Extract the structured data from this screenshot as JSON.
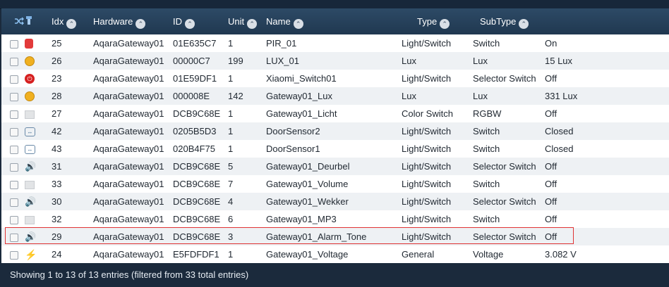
{
  "header": {
    "shuffle_icon": "shuffle-icon",
    "select_icon": "filter-icon",
    "columns": [
      {
        "key": "idx",
        "label": "Idx"
      },
      {
        "key": "hardware",
        "label": "Hardware"
      },
      {
        "key": "id",
        "label": "ID"
      },
      {
        "key": "unit",
        "label": "Unit"
      },
      {
        "key": "name",
        "label": "Name"
      },
      {
        "key": "type",
        "label": "Type"
      },
      {
        "key": "subtype",
        "label": "SubType"
      }
    ]
  },
  "rows": [
    {
      "icon": "motion-sensor-icon",
      "idx": "25",
      "hardware": "AqaraGateway01",
      "id": "01E635C7",
      "unit": "1",
      "name": "PIR_01",
      "type": "Light/Switch",
      "subtype": "Switch",
      "status": "On"
    },
    {
      "icon": "lux-bulb-icon",
      "idx": "26",
      "hardware": "AqaraGateway01",
      "id": "00000C7",
      "unit": "199",
      "name": "LUX_01",
      "type": "Lux",
      "subtype": "Lux",
      "status": "15 Lux"
    },
    {
      "icon": "power-switch-icon",
      "idx": "23",
      "hardware": "AqaraGateway01",
      "id": "01E59DF1",
      "unit": "1",
      "name": "Xiaomi_Switch01",
      "type": "Light/Switch",
      "subtype": "Selector Switch",
      "status": "Off"
    },
    {
      "icon": "lux-bulb-icon",
      "idx": "28",
      "hardware": "AqaraGateway01",
      "id": "000008E",
      "unit": "142",
      "name": "Gateway01_Lux",
      "type": "Lux",
      "subtype": "Lux",
      "status": "331 Lux"
    },
    {
      "icon": "rgb-light-icon",
      "idx": "27",
      "hardware": "AqaraGateway01",
      "id": "DCB9C68E",
      "unit": "1",
      "name": "Gateway01_Licht",
      "type": "Color Switch",
      "subtype": "RGBW",
      "status": "Off"
    },
    {
      "icon": "door-sensor-icon",
      "idx": "42",
      "hardware": "AqaraGateway01",
      "id": "0205B5D3",
      "unit": "1",
      "name": "DoorSensor2",
      "type": "Light/Switch",
      "subtype": "Switch",
      "status": "Closed"
    },
    {
      "icon": "door-sensor-icon",
      "idx": "43",
      "hardware": "AqaraGateway01",
      "id": "020B4F75",
      "unit": "1",
      "name": "DoorSensor1",
      "type": "Light/Switch",
      "subtype": "Switch",
      "status": "Closed"
    },
    {
      "icon": "speaker-icon",
      "idx": "31",
      "hardware": "AqaraGateway01",
      "id": "DCB9C68E",
      "unit": "5",
      "name": "Gateway01_Deurbel",
      "type": "Light/Switch",
      "subtype": "Selector Switch",
      "status": "Off"
    },
    {
      "icon": "rgb-light-icon",
      "idx": "33",
      "hardware": "AqaraGateway01",
      "id": "DCB9C68E",
      "unit": "7",
      "name": "Gateway01_Volume",
      "type": "Light/Switch",
      "subtype": "Switch",
      "status": "Off"
    },
    {
      "icon": "speaker-icon",
      "idx": "30",
      "hardware": "AqaraGateway01",
      "id": "DCB9C68E",
      "unit": "4",
      "name": "Gateway01_Wekker",
      "type": "Light/Switch",
      "subtype": "Selector Switch",
      "status": "Off"
    },
    {
      "icon": "rgb-light-icon",
      "idx": "32",
      "hardware": "AqaraGateway01",
      "id": "DCB9C68E",
      "unit": "6",
      "name": "Gateway01_MP3",
      "type": "Light/Switch",
      "subtype": "Switch",
      "status": "Off"
    },
    {
      "icon": "speaker-icon",
      "idx": "29",
      "hardware": "AqaraGateway01",
      "id": "DCB9C68E",
      "unit": "3",
      "name": "Gateway01_Alarm_Tone",
      "type": "Light/Switch",
      "subtype": "Selector Switch",
      "status": "Off"
    },
    {
      "icon": "voltage-icon",
      "idx": "24",
      "hardware": "AqaraGateway01",
      "id": "E5FDFDF1",
      "unit": "1",
      "name": "Gateway01_Voltage",
      "type": "General",
      "subtype": "Voltage",
      "status": "3.082 V"
    }
  ],
  "footer": {
    "info": "Showing 1 to 13 of 13 entries (filtered from 33 total entries)"
  },
  "colors": {
    "header_bg": "#26405a",
    "highlight_border": "#e03434"
  }
}
